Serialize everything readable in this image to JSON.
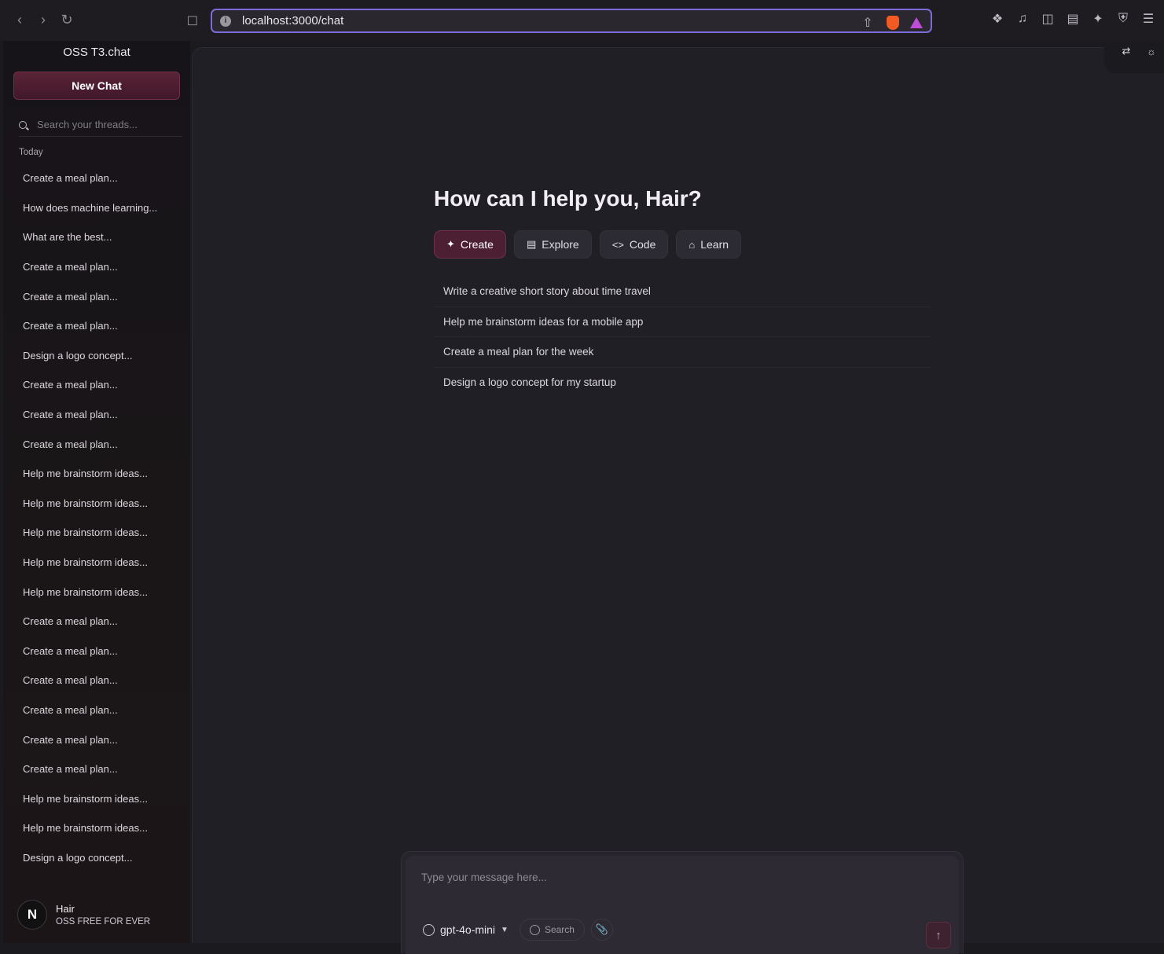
{
  "browser": {
    "url": "localhost:3000/chat"
  },
  "sidebar": {
    "app_title": "OSS T3.chat",
    "new_chat_label": "New Chat",
    "search_placeholder": "Search your threads...",
    "section_label": "Today",
    "threads": [
      "Create a meal plan...",
      "How does machine learning...",
      "What are the best...",
      "Create a meal plan...",
      "Create a meal plan...",
      "Create a meal plan...",
      "Design a logo concept...",
      "Create a meal plan...",
      "Create a meal plan...",
      "Create a meal plan...",
      "Help me brainstorm ideas...",
      "Help me brainstorm ideas...",
      "Help me brainstorm ideas...",
      "Help me brainstorm ideas...",
      "Help me brainstorm ideas...",
      "Create a meal plan...",
      "Create a meal plan...",
      "Create a meal plan...",
      "Create a meal plan...",
      "Create a meal plan...",
      "Create a meal plan...",
      "Help me brainstorm ideas...",
      "Help me brainstorm ideas...",
      "Design a logo concept..."
    ],
    "user": {
      "avatar_letter": "N",
      "name": "Hair",
      "plan": "OSS FREE FOR EVER"
    }
  },
  "main": {
    "greeting": "How can I help you, Hair?",
    "categories": [
      {
        "label": "Create",
        "icon": "sparkles-icon",
        "active": true
      },
      {
        "label": "Explore",
        "icon": "newspaper-icon",
        "active": false
      },
      {
        "label": "Code",
        "icon": "code-icon",
        "active": false
      },
      {
        "label": "Learn",
        "icon": "graduation-cap-icon",
        "active": false
      }
    ],
    "suggestions": [
      "Write a creative short story about time travel",
      "Help me brainstorm ideas for a mobile app",
      "Create a meal plan for the week",
      "Design a logo concept for my startup"
    ]
  },
  "composer": {
    "placeholder": "Type your message here...",
    "model": "gpt-4o-mini",
    "search_label": "Search"
  },
  "colors": {
    "accent": "#4d1f33",
    "accent_border": "#6e3049",
    "background": "#201f26",
    "sidebar": "#171419"
  }
}
